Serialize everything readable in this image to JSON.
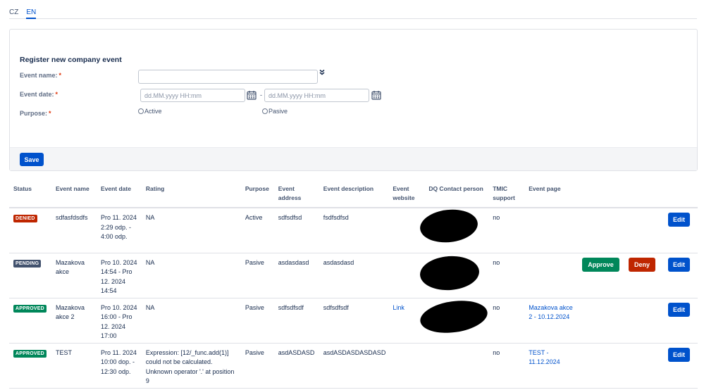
{
  "lang_tabs": [
    "CZ",
    "EN"
  ],
  "form": {
    "title": "Register new company event",
    "event_name_label": "Event name:",
    "event_date_label": "Event date:",
    "purpose_label": "Purpose:",
    "required_mark": "*",
    "date_placeholder": "dd.MM.yyyy HH:mm",
    "date_separator": "-",
    "purpose_options": [
      "Active",
      "Pasive"
    ],
    "save_label": "Save"
  },
  "table": {
    "headers": [
      "Status",
      "Event name",
      "Event date",
      "Rating",
      "Purpose",
      "Event address",
      "Event description",
      "Event website",
      "DQ Contact person",
      "TMIC support",
      "Event page"
    ],
    "rows": [
      {
        "status": "DENIED",
        "name": "sdfasfdsdfs",
        "date": "Pro 11. 2024 2:29 odp. - 4:00 odp.",
        "rating": "NA",
        "purpose": "Active",
        "address": "sdfsdfsd",
        "description": "fsdfsdfsd",
        "website": "",
        "tmic": "no",
        "page": "",
        "actions": [
          "Edit"
        ]
      },
      {
        "status": "PENDING",
        "name": "Mazakova akce",
        "date": "Pro 10. 2024 14:54 - Pro 12. 2024 14:54",
        "rating": "NA",
        "purpose": "Pasive",
        "address": "asdasdasd",
        "description": "asdasdasd",
        "website": "",
        "tmic": "no",
        "page": "",
        "actions": [
          "Approve",
          "Deny",
          "Edit"
        ]
      },
      {
        "status": "APPROVED",
        "name": "Mazakova akce 2",
        "date": "Pro 10. 2024 16:00 - Pro 12. 2024 17:00",
        "rating": "NA",
        "purpose": "Pasive",
        "address": "sdfsdfsdf",
        "description": "sdfsdfsdf",
        "website": "Link",
        "tmic": "no",
        "page": "Mazakova akce 2 - 10.12.2024",
        "actions": [
          "Edit"
        ]
      },
      {
        "status": "APPROVED",
        "name": "TEST",
        "date": "Pro 11. 2024 10:00 dop. - 12:30 odp.",
        "rating": "Expression: [12/_func.add(1)] could not be calculated. Unknown operator '.' at position 9",
        "purpose": "Pasive",
        "address": "asdASDASD",
        "description": "asdASDASDASDASD",
        "website": "",
        "tmic": "no",
        "page": "TEST - 11.12.2024",
        "actions": [
          "Edit"
        ]
      }
    ]
  },
  "colors": {
    "primary": "#0052cc",
    "approve": "#00875a",
    "deny": "#bf2600",
    "pending": "#42526e"
  }
}
